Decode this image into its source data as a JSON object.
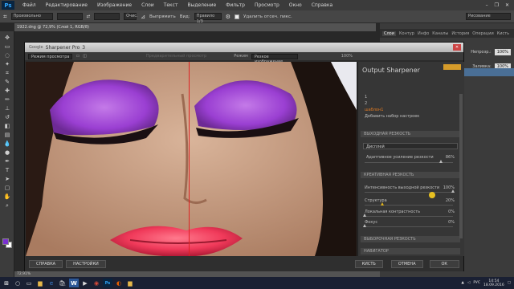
{
  "menubar": {
    "logo": "Ps",
    "items": [
      "Файл",
      "Редактирование",
      "Изображение",
      "Слои",
      "Текст",
      "Выделение",
      "Фильтр",
      "Просмотр",
      "Окно",
      "Справка"
    ]
  },
  "options": {
    "mode": "Произвольно",
    "swap": "⇄",
    "clear": "Очис.",
    "align_label": "Выпрямить",
    "view_label": "Вид:",
    "view_value": "Правило 1/3",
    "delete_label": "Удалить отсеч. пикс.",
    "workspace": "Рисование"
  },
  "doc_tab": "1922.dng @ 72,9% (Слой 1, RGB/8)",
  "right_panel": {
    "tabs": [
      "Слои",
      "Контур",
      "Инфо",
      "Каналы",
      "История",
      "Операции",
      "Кисть"
    ],
    "opacity_label": "Непрозр.:",
    "opacity_value": "100%",
    "fill_label": "Заливка:",
    "fill_value": "100%"
  },
  "dialog": {
    "brand": "Google",
    "title": "Sharpener Pro",
    "title_version": "3",
    "preview_mode_label": "Режим просмотра",
    "preview_before_after": "Предварительный просмотр",
    "mode_label": "Режим",
    "mode_value": "Резкое изображение",
    "zoom": "100%",
    "panel_title": "Output Sharpener",
    "presets": [
      "1",
      "2",
      "шаблон1"
    ],
    "add_preset": "Добавить набор настроек",
    "section_output": "ВЫХОДНАЯ РЕЗКОСТЬ",
    "output_type": "Дисплей",
    "adaptive_label": "Адаптивное усиление резкости",
    "adaptive_value": "86%",
    "section_creative": "КРЕАТИВНАЯ РЕЗКОСТЬ",
    "intensity_label": "Интенсивность выходной резкости",
    "intensity_value": "100%",
    "structure_label": "Структура",
    "structure_value": "20%",
    "local_label": "Локальная контрастность",
    "local_value": "0%",
    "focus_label": "Фокус",
    "focus_value": "0%",
    "section_selective": "ВЫБОРОЧНАЯ РЕЗКОСТЬ",
    "section_navigator": "НАВИГАТОР",
    "btn_help": "СПРАВКА",
    "btn_settings": "НАСТРОЙКИ",
    "btn_brush": "КИСТЬ",
    "btn_cancel": "ОТМЕНА",
    "btn_ok": "ОК"
  },
  "status": "72,91%",
  "taskbar": {
    "lang": "РУС",
    "time": "14:54",
    "date": "18.09.2016"
  },
  "colors": {
    "purple_shadow": "#a24fd6",
    "lips": "#f03a5a",
    "skin": "#c79a7e",
    "accent": "#d59b2a"
  },
  "values": {
    "adaptive": 0.86,
    "intensity": 1.0,
    "structure": 0.2,
    "local": 0.0,
    "focus": 0.0
  }
}
